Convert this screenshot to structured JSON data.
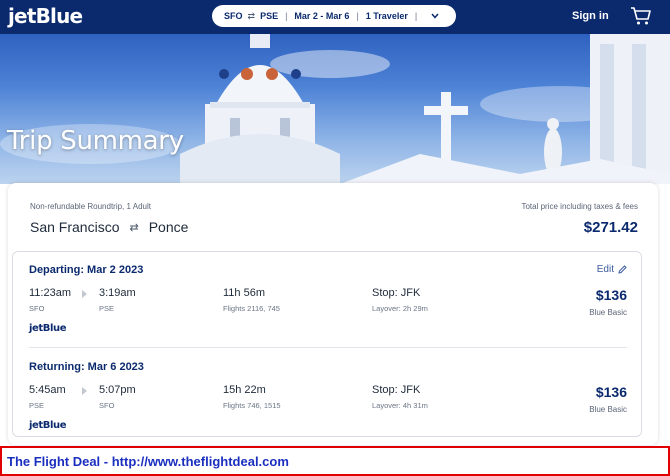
{
  "header": {
    "logo": "jetBlue",
    "search": {
      "origin": "SFO",
      "swap_icon": "⇄",
      "destination": "PSE",
      "dates": "Mar 2 - Mar 6",
      "travelers": "1 Traveler",
      "dropdown_icon": "chevron-down-icon"
    },
    "signin": "Sign in",
    "cart_icon": "cart-icon"
  },
  "hero": {
    "title": "Trip Summary"
  },
  "summary": {
    "trip_type": "Non-refundable Roundtrip, 1 Adult",
    "total_label": "Total price including taxes & fees",
    "origin_city": "San Francisco",
    "swap_icon": "⇄",
    "destination_city": "Ponce",
    "total_price": "$271.42"
  },
  "legs": [
    {
      "title": "Departing: Mar 2 2023",
      "edit": "Edit",
      "depart_time": "11:23am",
      "depart_airport": "SFO",
      "arrive_time": "3:19am",
      "arrive_airport": "PSE",
      "duration": "11h 56m",
      "flights": "Flights 2116, 745",
      "stop": "Stop: JFK",
      "layover": "Layover: 2h 29m",
      "price": "$136",
      "fare": "Blue Basic",
      "carrier": "jetBlue"
    },
    {
      "title": "Returning: Mar 6 2023",
      "depart_time": "5:45am",
      "depart_airport": "PSE",
      "arrive_time": "5:07pm",
      "arrive_airport": "SFO",
      "duration": "15h 22m",
      "flights": "Flights 746, 1515",
      "stop": "Stop: JFK",
      "layover": "Layover: 4h 31m",
      "price": "$136",
      "fare": "Blue Basic",
      "carrier": "jetBlue"
    }
  ],
  "banner": {
    "text": "The Flight Deal - http://www.theflightdeal.com"
  },
  "colors": {
    "brand_navy": "#0b2a6e",
    "banner_border": "#e00000",
    "banner_text": "#1b2fbf"
  }
}
